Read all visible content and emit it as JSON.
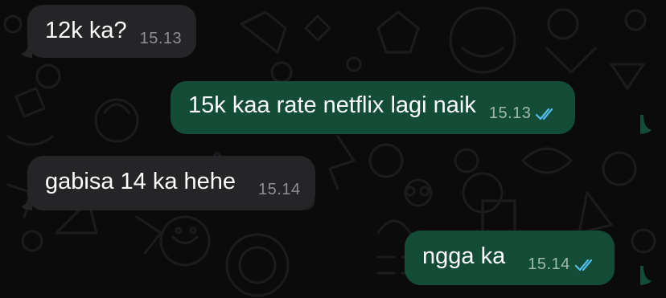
{
  "chat": {
    "messages": [
      {
        "direction": "incoming",
        "text": "12k ka?",
        "time": "15.13"
      },
      {
        "direction": "outgoing",
        "text": "15k kaa rate netflix lagi naik",
        "time": "15.13",
        "status": "read-double-check-icon"
      },
      {
        "direction": "incoming",
        "text": "gabisa 14 ka hehe",
        "time": "15.14"
      },
      {
        "direction": "outgoing",
        "text": "ngga ka",
        "time": "15.14",
        "status": "read-double-check-icon"
      }
    ]
  },
  "colors": {
    "background": "#0b0b0c",
    "incoming_bubble": "#252527",
    "outgoing_bubble": "#144d37",
    "read_ticks": "#53bdeb",
    "wallpaper_doodle": "#2a2a2c"
  }
}
